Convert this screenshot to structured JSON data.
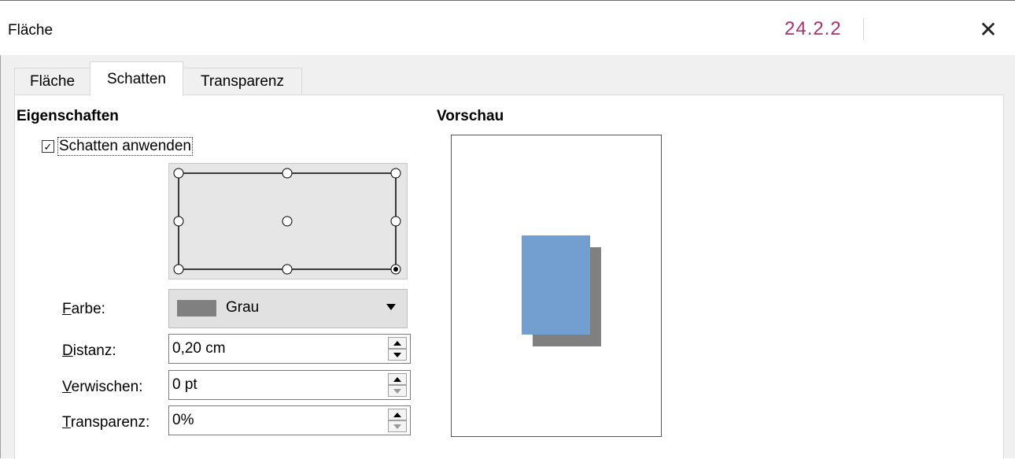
{
  "window": {
    "title": "Fläche",
    "version": "24.2.2",
    "close_glyph": "✕"
  },
  "tabs": [
    {
      "label": "Fläche",
      "active": false
    },
    {
      "label": "Schatten",
      "active": true
    },
    {
      "label": "Transparenz",
      "active": false
    }
  ],
  "properties": {
    "heading": "Eigenschaften",
    "apply_shadow": {
      "label": "Schatten anwenden",
      "checked": true,
      "check_glyph": "✓"
    },
    "position_grid": {
      "selected": "bottom-right"
    }
  },
  "fields": {
    "color": {
      "label": "Farbe:",
      "value": "Grau",
      "swatch": "#808080"
    },
    "distance": {
      "label": "Distanz:",
      "value": "0,20 cm"
    },
    "blur": {
      "label": "Verwischen:",
      "value": "0 pt"
    },
    "transparency": {
      "label": "Transparenz:",
      "value": "0%"
    }
  },
  "preview": {
    "heading": "Vorschau",
    "object_color": "#729fcf",
    "shadow_color": "#808080"
  }
}
